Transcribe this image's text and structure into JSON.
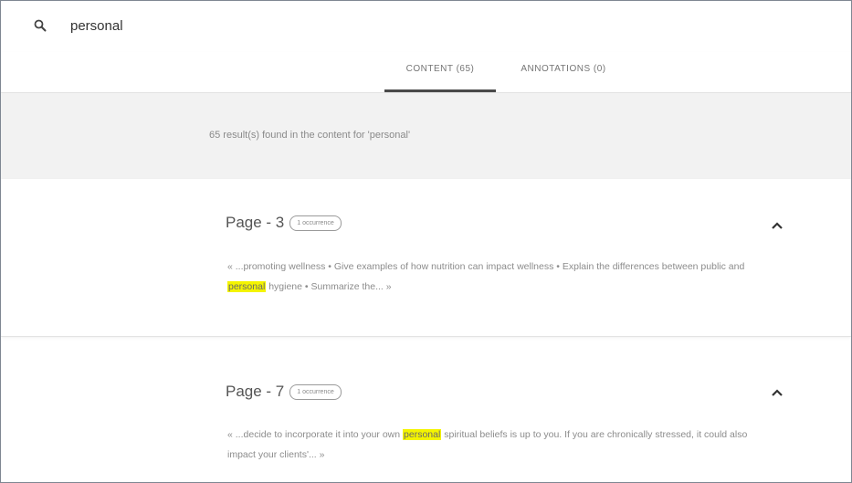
{
  "search": {
    "value": "personal",
    "icon": "search-icon"
  },
  "tabs": [
    {
      "label": "CONTENT (65)",
      "active": true
    },
    {
      "label": "ANNOTATIONS (0)",
      "active": false
    }
  ],
  "summary": "65 result(s) found in the content for 'personal'",
  "results": [
    {
      "title": "Page - 3",
      "badge": "1 occurrence",
      "snippet_before": "« ...promoting wellness • Give examples of how nutrition can impact wellness • Explain the differences between public and ",
      "highlight": "personal",
      "snippet_after": " hygiene • Summarize the... ",
      "more": "»"
    },
    {
      "title": "Page - 7",
      "badge": "1 occurrence",
      "snippet_before": "« ...decide to incorporate it into your own ",
      "highlight": "personal",
      "snippet_after": " spiritual beliefs is up to you. If you are chronically stressed, it could also impact your clients'... ",
      "more": "»"
    }
  ],
  "colors": {
    "highlight": "#f4f400",
    "active_tab_underline": "#4a4a4a",
    "summary_band": "#f2f2f2"
  }
}
